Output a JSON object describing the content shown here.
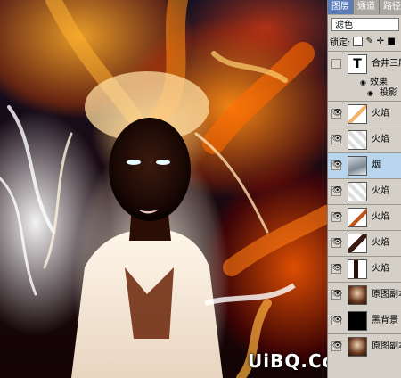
{
  "panel": {
    "tabs": [
      "图层",
      "通道",
      "路径"
    ],
    "active_tab": 0,
    "blend_mode": "滤色",
    "lock_label": "锁定:",
    "layers": [
      {
        "name": "合井三层",
        "kind": "text",
        "visible": false,
        "selected": false
      },
      {
        "name": "火焰",
        "kind": "fire",
        "visible": true,
        "selected": false
      },
      {
        "name": "火焰",
        "kind": "fire",
        "visible": true,
        "selected": false
      },
      {
        "name": "烟",
        "kind": "smoke",
        "visible": true,
        "selected": true
      },
      {
        "name": "火焰",
        "kind": "fire",
        "visible": true,
        "selected": false
      },
      {
        "name": "火焰",
        "kind": "fire",
        "visible": true,
        "selected": false
      },
      {
        "name": "火焰",
        "kind": "fire",
        "visible": true,
        "selected": false
      },
      {
        "name": "火焰",
        "kind": "fire",
        "visible": true,
        "selected": false
      },
      {
        "name": "原图副本",
        "kind": "photo",
        "visible": true,
        "selected": false
      },
      {
        "name": "黑背景",
        "kind": "black",
        "visible": true,
        "selected": false
      },
      {
        "name": "原图副本",
        "kind": "photo",
        "visible": true,
        "selected": false
      }
    ],
    "effects": {
      "label": "效果",
      "items": [
        "投影"
      ]
    },
    "text_layer_glyph": "T"
  },
  "watermark": "UiBQ.CoM",
  "icons": {
    "eye": "eye-icon",
    "effects": "fx-eye-icon",
    "lock_transparent": "lock-transparent-icon",
    "lock_paint": "lock-paint-icon",
    "lock_move": "lock-move-icon",
    "lock_all": "lock-all-icon"
  },
  "colors": {
    "selection": "#b9d5ee",
    "panel": "#d4d0c8",
    "active_tab": "#5a7db8"
  }
}
